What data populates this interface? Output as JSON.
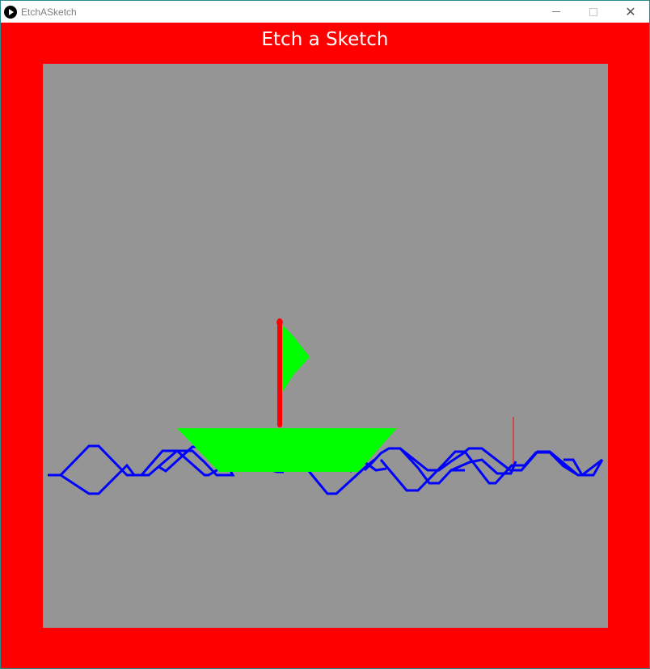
{
  "window": {
    "title": "EtchASketch",
    "icon": "play-icon",
    "controls": {
      "minimize_icon": "minimize-icon",
      "maximize_icon": "maximize-icon",
      "close_icon": "close-icon",
      "close_glyph": "✕"
    }
  },
  "sketch": {
    "heading": "Etch a Sketch",
    "colors": {
      "frame": "#ff0000",
      "canvas": "#959595",
      "waves": "#0000ff",
      "boat": "#00ff00",
      "mast": "#ff0000",
      "cursor": "#ff0000"
    },
    "drawing": {
      "waves": "blue zigzag lines",
      "hull": "green trapezoid",
      "sail": "green sail",
      "mast": "red mast",
      "cursor": "red thin vertical stroke"
    }
  }
}
